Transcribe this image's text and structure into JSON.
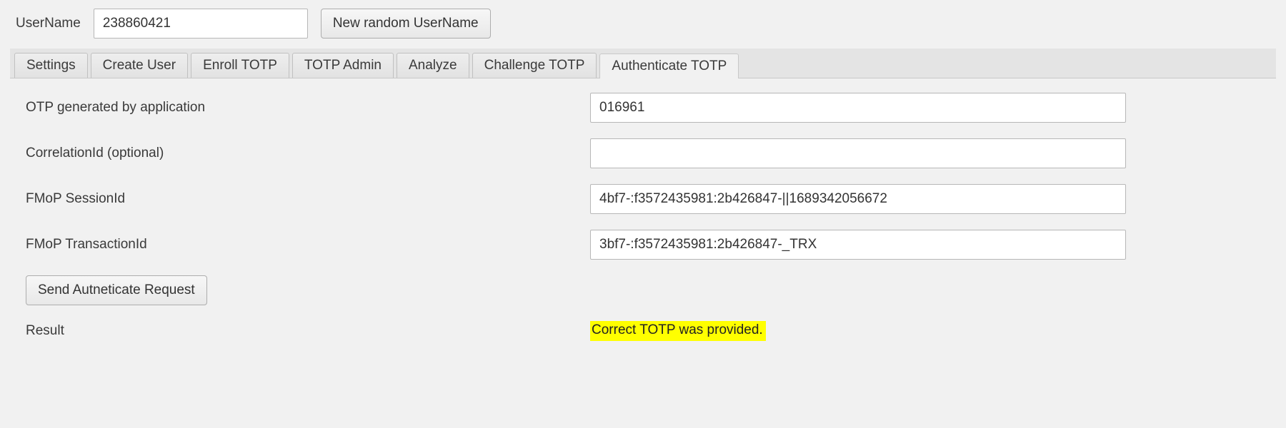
{
  "top": {
    "usernameLabel": "UserName",
    "usernameValue": "238860421",
    "newRandomButton": "New random UserName"
  },
  "tabs": [
    {
      "label": "Settings"
    },
    {
      "label": "Create User"
    },
    {
      "label": "Enroll TOTP"
    },
    {
      "label": "TOTP Admin"
    },
    {
      "label": "Analyze"
    },
    {
      "label": "Challenge TOTP"
    },
    {
      "label": "Authenticate TOTP"
    }
  ],
  "activeTabIndex": 6,
  "form": {
    "otpLabel": "OTP generated by application",
    "otpValue": "016961",
    "correlationLabel": "CorrelationId  (optional)",
    "correlationValue": "",
    "sessionLabel": "FMoP SessionId",
    "sessionValue": "4bf7-:f3572435981:2b426847-||1689342056672",
    "transactionLabel": "FMoP TransactionId",
    "transactionValue": "3bf7-:f3572435981:2b426847-_TRX",
    "sendButton": "Send Autneticate Request",
    "resultLabel": "Result",
    "resultValue": "Correct TOTP was provided."
  }
}
